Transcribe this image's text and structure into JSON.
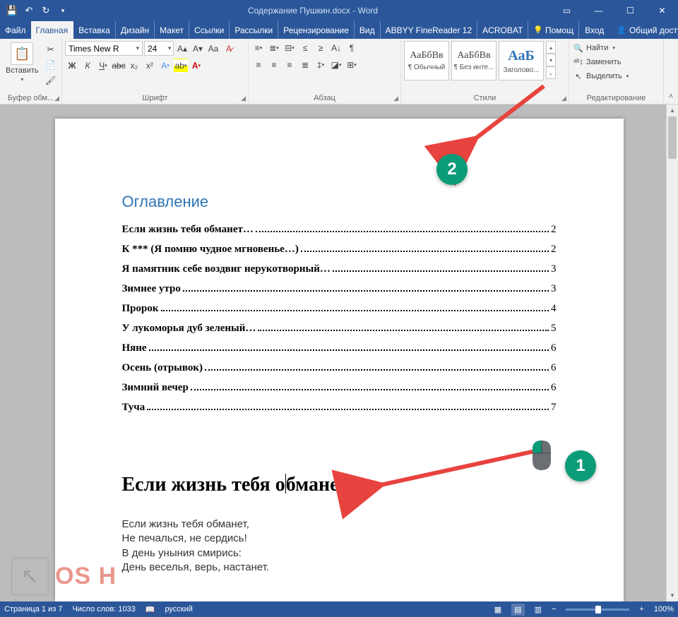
{
  "window": {
    "title": "Содержание Пушкин.docx - Word"
  },
  "tabs": {
    "file": "Файл",
    "home": "Главная",
    "insert": "Вставка",
    "design": "Дизайн",
    "layout": "Макет",
    "references": "Ссылки",
    "mailings": "Рассылки",
    "review": "Рецензирование",
    "view": "Вид",
    "finereader": "ABBYY FineReader 12",
    "acrobat": "ACROBAT",
    "help": "Помощ",
    "login": "Вход",
    "share": "Общий доступ"
  },
  "ribbon": {
    "clipboard": {
      "paste": "Вставить",
      "label": "Буфер обм..."
    },
    "font": {
      "name": "Times New R",
      "size": "24",
      "label": "Шрифт"
    },
    "paragraph": {
      "label": "Абзац"
    },
    "styles": {
      "label": "Стили",
      "items": [
        {
          "preview": "АаБбВв",
          "name": "¶ Обычный"
        },
        {
          "preview": "АаБбВв",
          "name": "¶ Без инте..."
        },
        {
          "preview": "АаБ",
          "name": "Заголово..."
        }
      ]
    },
    "editing": {
      "find": "Найти",
      "replace": "Заменить",
      "select": "Выделить",
      "label": "Редактирование"
    }
  },
  "document": {
    "toc_title": "Оглавление",
    "toc": [
      {
        "title": "Если жизнь тебя обманет…",
        "page": "2"
      },
      {
        "title": "К *** (Я помню чудное мгновенье…)",
        "page": "2"
      },
      {
        "title": "Я памятник себе воздвиг нерукотворный…",
        "page": "3"
      },
      {
        "title": "Зимнее утро",
        "page": "3"
      },
      {
        "title": "Пророк",
        "page": "4"
      },
      {
        "title": "У лукоморья дуб зеленый…",
        "page": "5"
      },
      {
        "title": "Няне",
        "page": "6"
      },
      {
        "title": "Осень (отрывок)",
        "page": "6"
      },
      {
        "title": "Зимний вечер",
        "page": "6"
      },
      {
        "title": "Туча",
        "page": "7"
      }
    ],
    "heading_before": "Если жизнь тебя о",
    "heading_after": "бманет…",
    "body_lines": [
      "Если жизнь тебя обманет,",
      "Не печалься, не сердись!",
      "В день уныния смирись:",
      "День веселья, верь, настанет."
    ]
  },
  "status": {
    "page": "Страница 1 из 7",
    "words": "Число слов: 1033",
    "lang": "русский",
    "zoom": "100%"
  },
  "annotations": {
    "c1": "1",
    "c2": "2"
  },
  "watermark": "OS H"
}
